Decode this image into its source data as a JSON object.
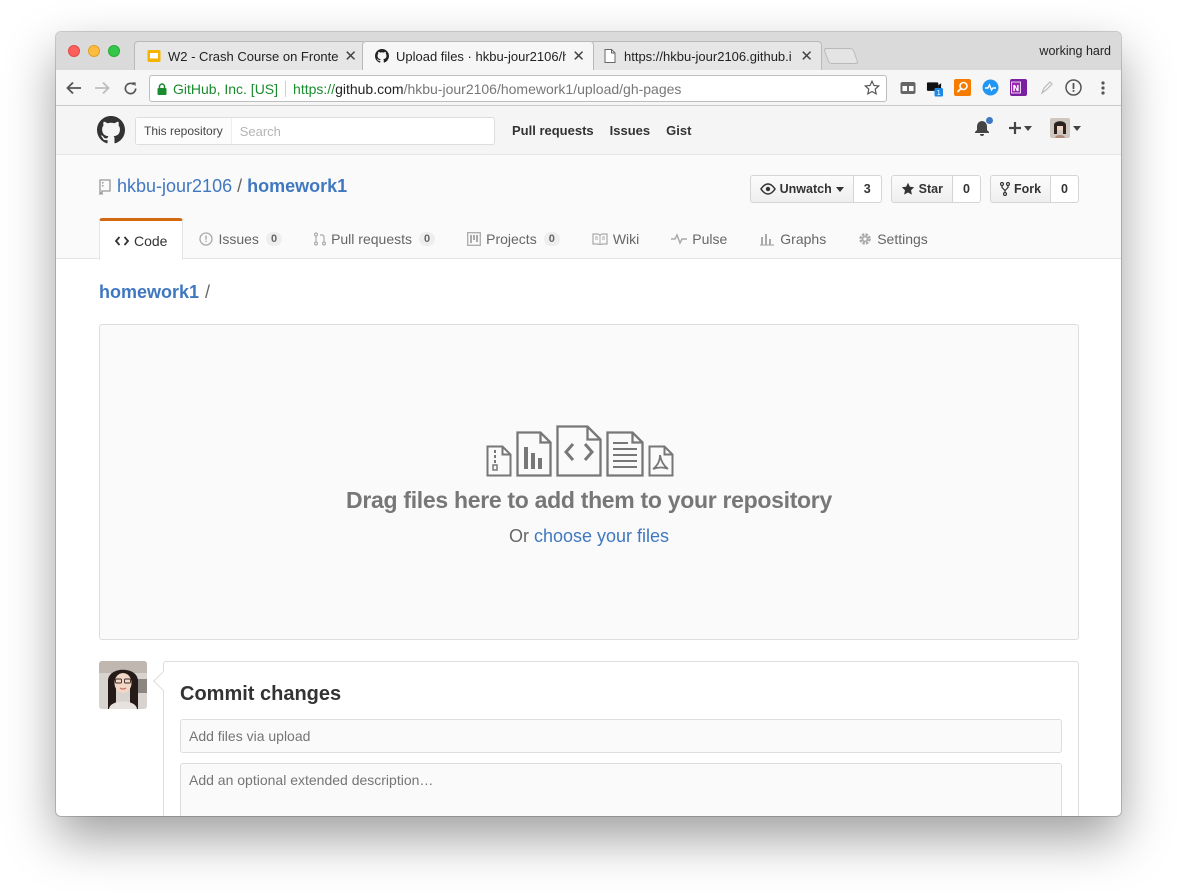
{
  "browser": {
    "profile_name": "working hard",
    "tabs": [
      {
        "title": "W2 - Crash Course on Fronten",
        "favicon": "slides-icon"
      },
      {
        "title": "Upload files · hkbu-jour2106/h",
        "favicon": "github-icon"
      },
      {
        "title": "https://hkbu-jour2106.github.i",
        "favicon": "page-icon"
      }
    ],
    "security_label": "GitHub, Inc. [US]",
    "url_scheme": "https://",
    "url_host": "github.com",
    "url_path": "/hkbu-jour2106/homework1/upload/gh-pages",
    "extension_badge": "1"
  },
  "header": {
    "search_scope": "This repository",
    "search_placeholder": "Search",
    "nav": [
      "Pull requests",
      "Issues",
      "Gist"
    ]
  },
  "repo": {
    "owner": "hkbu-jour2106",
    "separator": "/",
    "name": "homework1",
    "watch_label": "Unwatch",
    "watch_count": "3",
    "star_label": "Star",
    "star_count": "0",
    "fork_label": "Fork",
    "fork_count": "0",
    "tabs": [
      {
        "label": "Code",
        "icon": "code-icon"
      },
      {
        "label": "Issues",
        "count": "0",
        "icon": "issue-icon"
      },
      {
        "label": "Pull requests",
        "count": "0",
        "icon": "pull-request-icon"
      },
      {
        "label": "Projects",
        "count": "0",
        "icon": "project-icon"
      },
      {
        "label": "Wiki",
        "icon": "book-icon"
      },
      {
        "label": "Pulse",
        "icon": "pulse-icon"
      },
      {
        "label": "Graphs",
        "icon": "graph-icon"
      },
      {
        "label": "Settings",
        "icon": "gear-icon"
      }
    ]
  },
  "upload": {
    "breadcrumb_root": "homework1",
    "breadcrumb_sep": "/",
    "drop_title": "Drag files here to add them to your repository",
    "drop_or": "Or",
    "drop_link": "choose your files"
  },
  "commit": {
    "title": "Commit changes",
    "summary_placeholder": "Add files via upload",
    "description_placeholder": "Add an optional extended description…"
  },
  "colors": {
    "link": "#4078c0",
    "tab_accent": "#d26911",
    "secure_green": "#1a8b2e"
  }
}
